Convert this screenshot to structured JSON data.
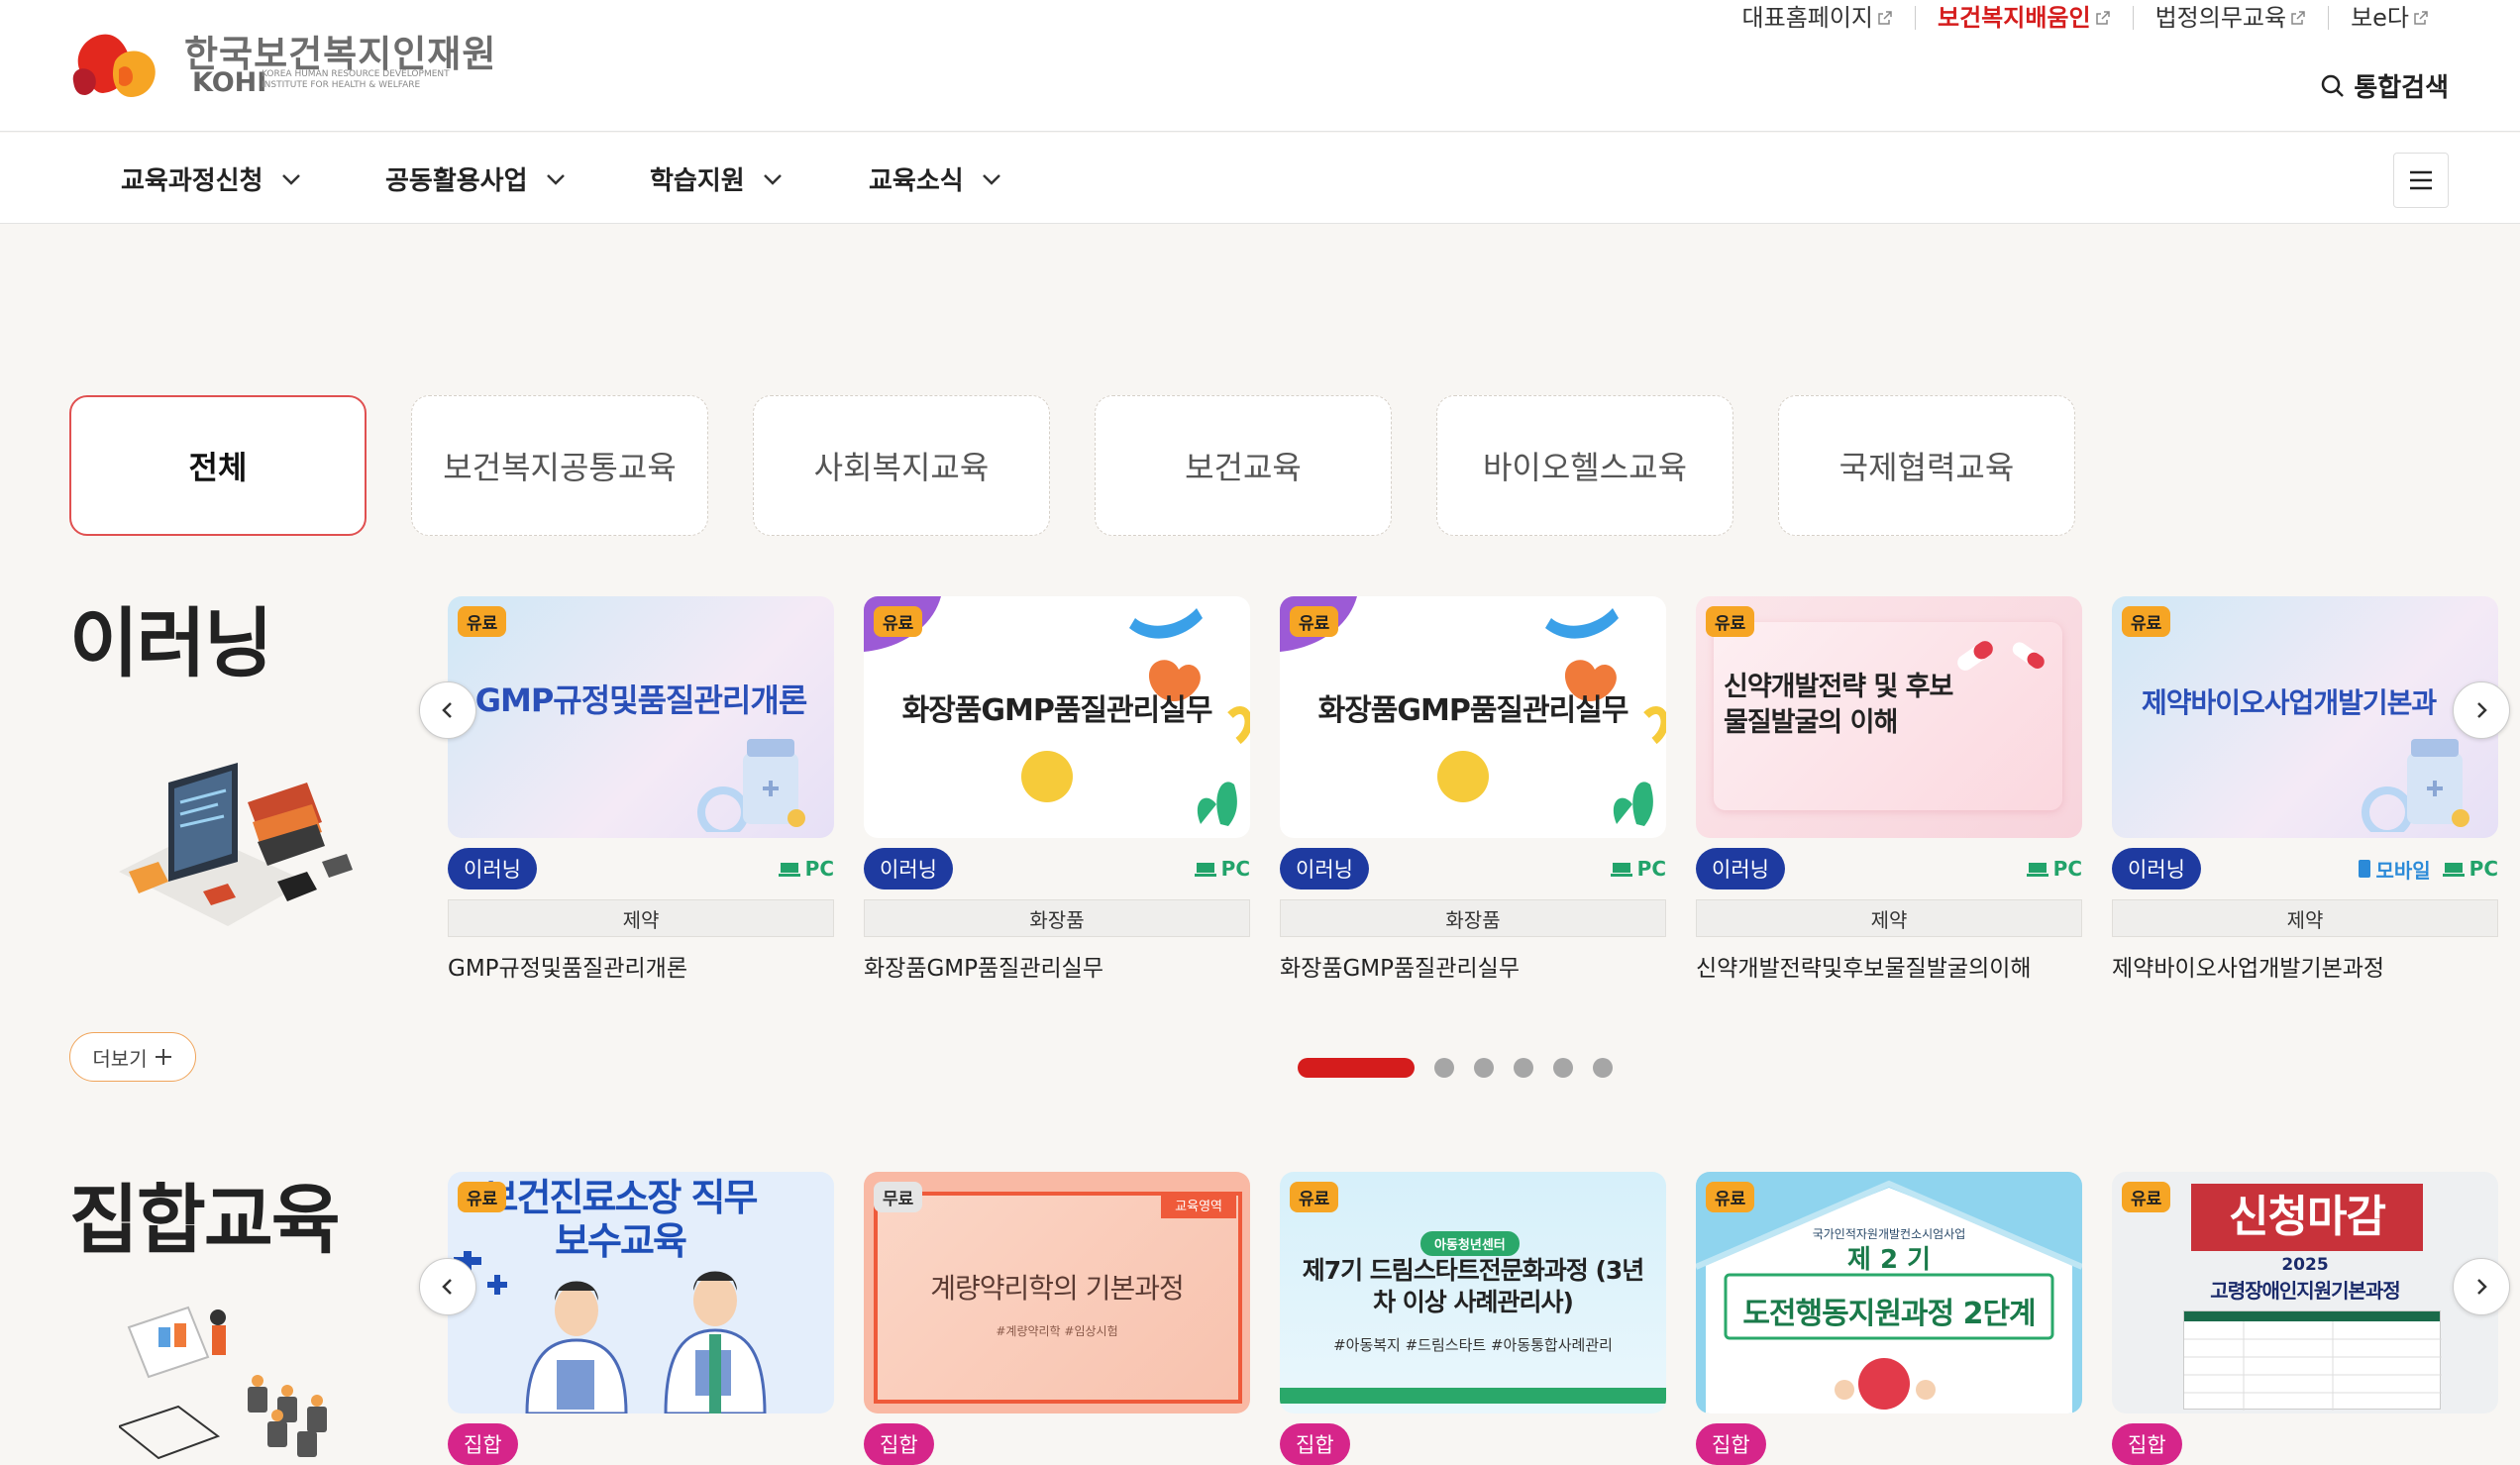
{
  "header": {
    "logo": {
      "ko": "한국보건복지인재원",
      "en": "KOHI",
      "sub": "KOREA HUMAN RESOURCE DEVELOPMENT INSTITUTE FOR HEALTH & WELFARE"
    },
    "util_links": [
      {
        "label": "대표홈페이지",
        "highlight": false
      },
      {
        "label": "보건복지배움인",
        "highlight": true
      },
      {
        "label": "법정의무교육",
        "highlight": false
      },
      {
        "label": "보e다",
        "highlight": false
      }
    ],
    "search_label": "통합검색"
  },
  "nav": {
    "items": [
      "교육과정신청",
      "공동활용사업",
      "학습지원",
      "교육소식"
    ]
  },
  "tabs": [
    "전체",
    "보건복지공통교육",
    "사회복지교육",
    "보건교육",
    "바이오헬스교육",
    "국제협력교육"
  ],
  "sections": {
    "elearning": {
      "title": "이러닝",
      "more_label": "더보기",
      "cards": [
        {
          "badge": "유료",
          "thumb_text": "GMP규정및품질관리개론",
          "type": "이러닝",
          "devices": [
            "PC"
          ],
          "category": "제약",
          "name": "GMP규정및품질관리개론"
        },
        {
          "badge": "유료",
          "thumb_text": "화장품GMP품질관리실무",
          "type": "이러닝",
          "devices": [
            "PC"
          ],
          "category": "화장품",
          "name": "화장품GMP품질관리실무"
        },
        {
          "badge": "유료",
          "thumb_text": "화장품GMP품질관리실무",
          "type": "이러닝",
          "devices": [
            "PC"
          ],
          "category": "화장품",
          "name": "화장품GMP품질관리실무"
        },
        {
          "badge": "유료",
          "thumb_text": "신약개발전략 및 후보물질발굴의 이해",
          "type": "이러닝",
          "devices": [
            "PC"
          ],
          "category": "제약",
          "name": "신약개발전략및후보물질발굴의이해"
        },
        {
          "badge": "유료",
          "thumb_text": "제약바이오사업개발기본과",
          "type": "이러닝",
          "devices": [
            "모바일",
            "PC"
          ],
          "category": "제약",
          "name": "제약바이오사업개발기본과정"
        }
      ]
    },
    "group": {
      "title": "집합교육",
      "cards": [
        {
          "badge": "유료",
          "thumb_text": "보건진료소장 직무보수교육",
          "type": "집합"
        },
        {
          "badge": "무료",
          "thumb_text": "계량약리학의 기본과정",
          "thumb_tag": "교육영역",
          "thumb_sub": "#계량약리학 #임상시험",
          "type": "집합"
        },
        {
          "badge": "유료",
          "thumb_org": "아동청년센터",
          "thumb_text": "제7기 드림스타트전문화과정 (3년차 이상 사례관리사)",
          "thumb_sub": "#아동복지 #드림스타트 #아동통합사례관리",
          "type": "집합"
        },
        {
          "badge": "유료",
          "thumb_org": "국가인적자원개발컨소시엄사업",
          "thumb_num": "제 2 기",
          "thumb_text": "도전행동지원과정 2단계",
          "type": "집합"
        },
        {
          "badge": "유료",
          "thumb_stamp": "신청마감",
          "thumb_year": "2025",
          "thumb_text": "고령장애인지원기본과정",
          "type": "집합"
        }
      ]
    }
  },
  "slider": {
    "pages": 6,
    "active": 0
  },
  "colors": {
    "accent": "#d51c1c",
    "nav_pill": "#1e3aa0",
    "group_pill": "#d6258a",
    "paid_badge": "#f6a524",
    "pc": "#22a36a",
    "mobile": "#2b8ad8"
  }
}
